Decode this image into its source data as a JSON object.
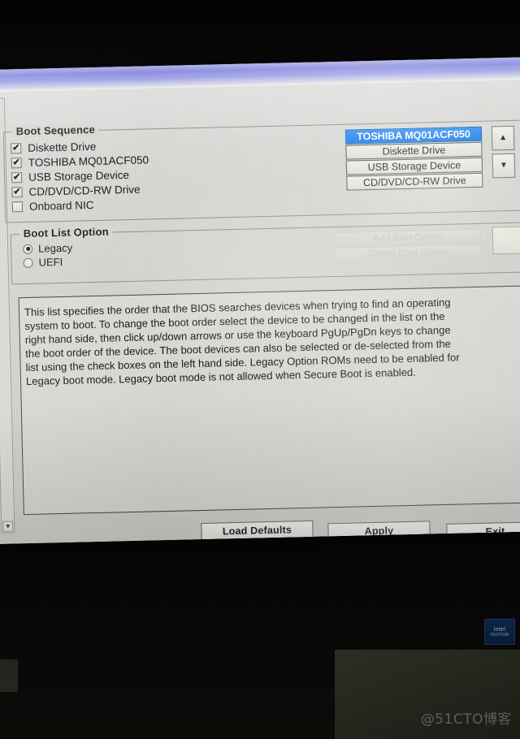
{
  "screen": {
    "boot_sequence": {
      "legend": "Boot Sequence",
      "devices": [
        {
          "label": "Diskette Drive",
          "checked": true
        },
        {
          "label": "TOSHIBA MQ01ACF050",
          "checked": true
        },
        {
          "label": "USB Storage Device",
          "checked": true
        },
        {
          "label": "CD/DVD/CD-RW Drive",
          "checked": true
        },
        {
          "label": "Onboard NIC",
          "checked": false
        }
      ],
      "order_list": [
        {
          "label": "TOSHIBA MQ01ACF050",
          "selected": true
        },
        {
          "label": "Diskette Drive",
          "selected": false
        },
        {
          "label": "USB Storage Device",
          "selected": false
        },
        {
          "label": "CD/DVD/CD-RW Drive",
          "selected": false
        }
      ],
      "move_up_icon": "▲",
      "move_down_icon": "▼"
    },
    "boot_list_option": {
      "legend": "Boot List Option",
      "options": [
        {
          "label": "Legacy",
          "selected": true
        },
        {
          "label": "UEFI",
          "selected": false
        }
      ],
      "disabled_buttons": [
        "Add Boot Option",
        "Delete Boot Option"
      ]
    },
    "description": {
      "lines": [
        "This list specifies the order that the BIOS searches devices when trying to find an operating",
        "system to boot. To change the boot order select the device to be changed in the list on the",
        "right hand side, then click up/down arrows or use the keyboard PgUp/PgDn keys to change",
        "the boot order of the device. The boot devices can also be selected or de-selected from the",
        "list using the check boxes on the left hand side. Legacy Option ROMs need to be enabled for",
        "Legacy boot mode. Legacy boot mode is not allowed when Secure Boot is enabled."
      ]
    },
    "buttons": {
      "load_defaults": "Load Defaults",
      "apply": "Apply",
      "exit": "Exit"
    },
    "outer_scroll_down_icon": "▼"
  },
  "photo": {
    "watermark": "@51CTO博客",
    "intel_sticker": {
      "line1": "intel",
      "line2": "PENTIUM"
    }
  },
  "colors": {
    "selection_blue": "#1478ea",
    "window_chrome": "#6f74dc",
    "panel_gray": "#d2d3ce",
    "text": "#141414"
  }
}
